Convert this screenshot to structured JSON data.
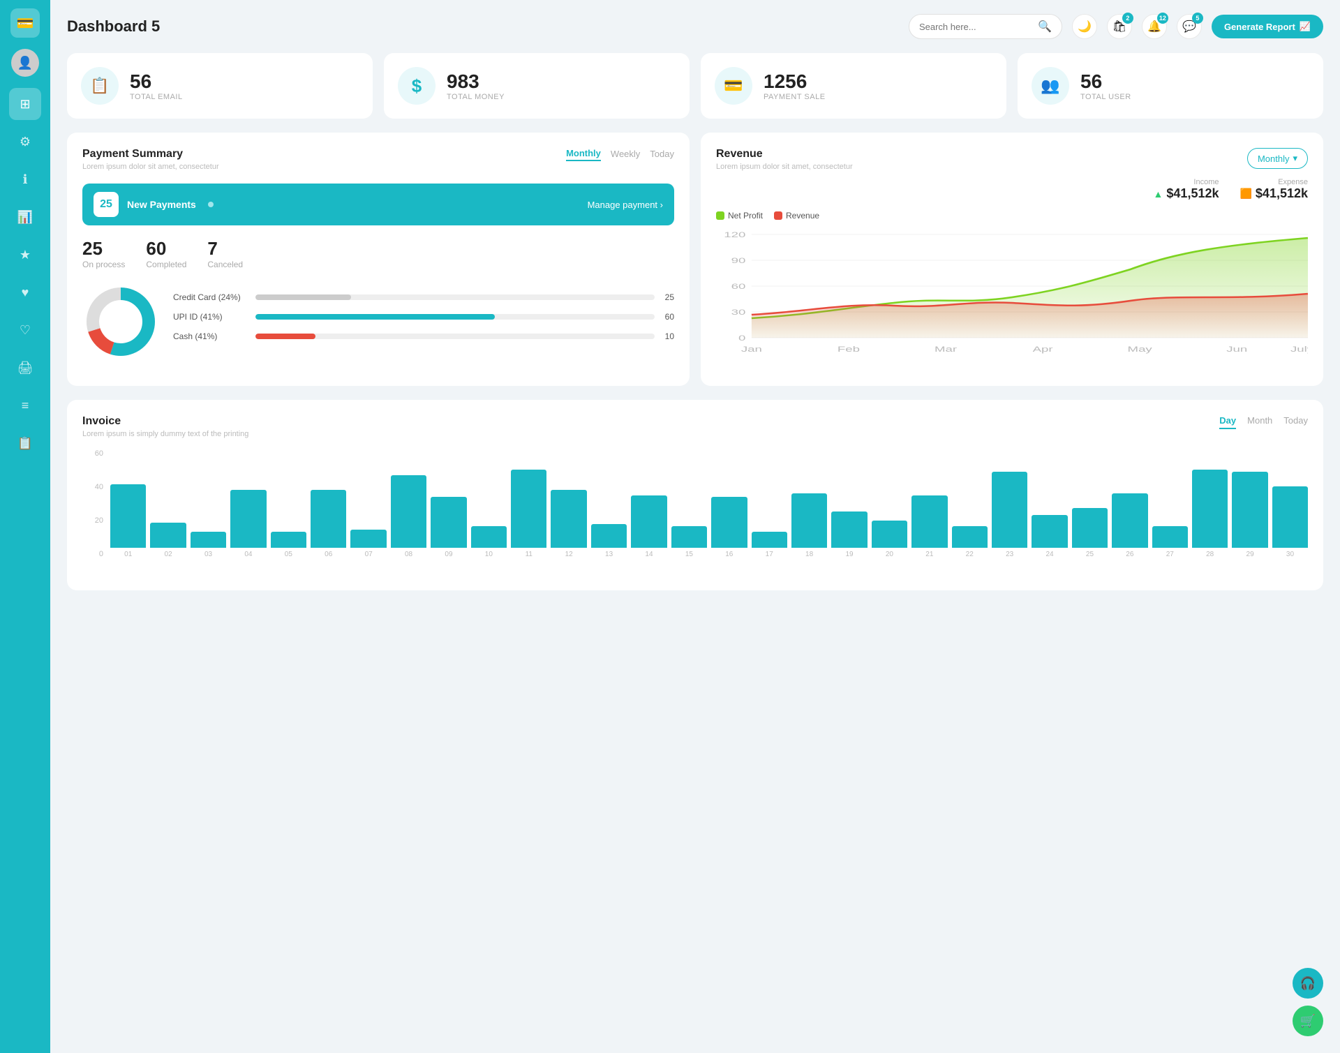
{
  "sidebar": {
    "logo_icon": "💳",
    "items": [
      {
        "id": "avatar",
        "icon": "👤",
        "active": false
      },
      {
        "id": "dashboard",
        "icon": "⊞",
        "active": true
      },
      {
        "id": "settings",
        "icon": "⚙",
        "active": false
      },
      {
        "id": "info",
        "icon": "ℹ",
        "active": false
      },
      {
        "id": "chart",
        "icon": "📊",
        "active": false
      },
      {
        "id": "star",
        "icon": "★",
        "active": false
      },
      {
        "id": "heart-filled",
        "icon": "♥",
        "active": false
      },
      {
        "id": "heart-outline",
        "icon": "♡",
        "active": false
      },
      {
        "id": "print",
        "icon": "🖨",
        "active": false
      },
      {
        "id": "list",
        "icon": "≡",
        "active": false
      },
      {
        "id": "doc",
        "icon": "📋",
        "active": false
      }
    ]
  },
  "topbar": {
    "title": "Dashboard 5",
    "search_placeholder": "Search here...",
    "generate_btn": "Generate Report",
    "notifications": [
      {
        "icon": "🛍",
        "badge": "2"
      },
      {
        "icon": "🔔",
        "badge": "12"
      },
      {
        "icon": "💬",
        "badge": "5"
      }
    ],
    "theme_icon": "🌙"
  },
  "stat_cards": [
    {
      "id": "email",
      "icon": "📋",
      "value": "56",
      "label": "TOTAL EMAIL"
    },
    {
      "id": "money",
      "icon": "$",
      "value": "983",
      "label": "TOTAL MONEY"
    },
    {
      "id": "payment",
      "icon": "💳",
      "value": "1256",
      "label": "PAYMENT SALE"
    },
    {
      "id": "user",
      "icon": "👥",
      "value": "56",
      "label": "TOTAL USER"
    }
  ],
  "payment_summary": {
    "title": "Payment Summary",
    "subtitle": "Lorem ipsum dolor sit amet, consectetur",
    "tabs": [
      "Monthly",
      "Weekly",
      "Today"
    ],
    "active_tab": "Monthly",
    "new_payments_count": "25",
    "new_payments_label": "New Payments",
    "manage_link": "Manage payment",
    "stats": [
      {
        "value": "25",
        "label": "On process"
      },
      {
        "value": "60",
        "label": "Completed"
      },
      {
        "value": "7",
        "label": "Canceled"
      }
    ],
    "payment_methods": [
      {
        "label": "Credit Card (24%)",
        "percent": 24,
        "color": "#ccc",
        "value": "25"
      },
      {
        "label": "UPI ID (41%)",
        "percent": 60,
        "color": "#1ab8c4",
        "value": "60"
      },
      {
        "label": "Cash (41%)",
        "percent": 15,
        "color": "#e74c3c",
        "value": "10"
      }
    ]
  },
  "revenue": {
    "title": "Revenue",
    "subtitle": "Lorem ipsum dolor sit amet, consectetur",
    "active_tab": "Monthly",
    "income_label": "Income",
    "income_value": "$41,512k",
    "expense_label": "Expense",
    "expense_value": "$41,512k",
    "legend": [
      {
        "label": "Net Profit",
        "color": "#7ed321"
      },
      {
        "label": "Revenue",
        "color": "#e74c3c"
      }
    ],
    "x_labels": [
      "Jan",
      "Feb",
      "Mar",
      "Apr",
      "May",
      "Jun",
      "July"
    ],
    "y_labels": [
      "120",
      "90",
      "60",
      "30",
      "0"
    ]
  },
  "invoice": {
    "title": "Invoice",
    "subtitle": "Lorem ipsum is simply dummy text of the printing",
    "tabs": [
      "Day",
      "Month",
      "Today"
    ],
    "active_tab": "Day",
    "y_labels": [
      "60",
      "40",
      "20",
      "0"
    ],
    "x_labels": [
      "01",
      "02",
      "03",
      "04",
      "05",
      "06",
      "07",
      "08",
      "09",
      "10",
      "11",
      "12",
      "13",
      "14",
      "15",
      "16",
      "17",
      "18",
      "19",
      "20",
      "21",
      "22",
      "23",
      "24",
      "25",
      "26",
      "27",
      "28",
      "29",
      "30"
    ],
    "bar_data": [
      35,
      14,
      9,
      32,
      9,
      32,
      10,
      40,
      28,
      12,
      43,
      32,
      13,
      29,
      12,
      28,
      9,
      30,
      20,
      15,
      29,
      12,
      42,
      18,
      22,
      30,
      12,
      43,
      42,
      34
    ]
  },
  "fab": [
    {
      "icon": "🎧",
      "color": "#1ab8c4"
    },
    {
      "icon": "🛒",
      "color": "#2ecc71"
    }
  ]
}
